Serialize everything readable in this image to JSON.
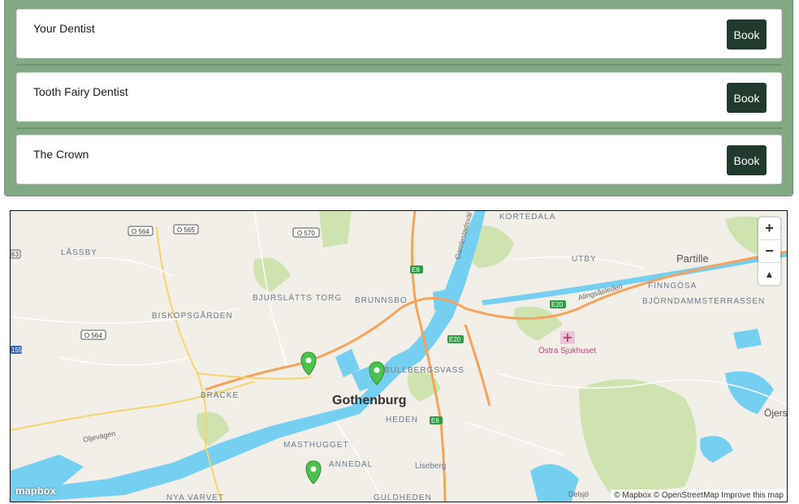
{
  "clinics": [
    {
      "name": "Your Dentist",
      "button": "Book"
    },
    {
      "name": "Tooth Fairy Dentist",
      "button": "Book"
    },
    {
      "name": "The Crown",
      "button": "Book"
    }
  ],
  "map": {
    "city_label": "Gothenburg",
    "place_labels": [
      "KORTEDALA",
      "LÅSSBY",
      "UTBY",
      "Partille",
      "BJURSLÄTTS TORG",
      "BRUNNSBO",
      "BISKOPSGÅRDEN",
      "FINNGÖSA",
      "BJÖRNDAMMSTERRASSEN",
      "Östra Sjukhuset",
      "BULLBERGSVASS",
      "BRÄCKE",
      "HEDEN",
      "MASTHUGGET",
      "ANNEDAL",
      "Liseberg",
      "NYA VARVET",
      "GULDHEDEN",
      "Öjers",
      "Oljevägen",
      "Alingsåsleden",
      "Delsjö",
      "Gamlestadsväl"
    ],
    "road_shields": [
      "O 564",
      "O 565",
      "O 570",
      "O 564",
      "E6",
      "E20",
      "E20",
      "E6",
      "155",
      "63"
    ],
    "zoom_in": "+",
    "zoom_out": "−",
    "compass": "▲",
    "logo": "mapbox",
    "attribution": "© Mapbox © OpenStreetMap  Improve this map",
    "marker_color": "#4cc24c"
  }
}
